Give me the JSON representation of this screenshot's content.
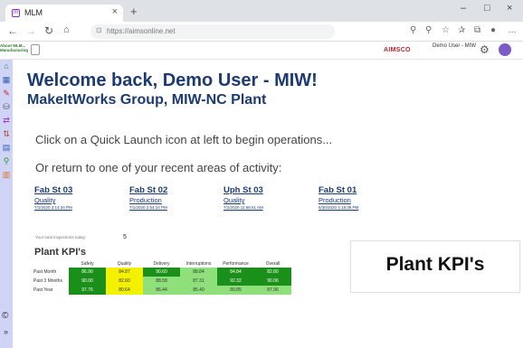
{
  "browser": {
    "tab_title": "MLM",
    "tab_favicon": "mlm-favicon",
    "url": "https://aimsonline.net",
    "window_controls": [
      "–",
      "□",
      "×"
    ]
  },
  "app": {
    "logo_text": "About MLM... Manufacturing",
    "brand": "AIMSCO",
    "user_label": "Demo User - MIW"
  },
  "sidebar": {
    "icons": [
      "home-icon",
      "calendar-icon",
      "wrench-icon",
      "database-icon",
      "transfer-icon",
      "arrows-icon",
      "clipboard-icon",
      "search-icon",
      "bar-chart-icon"
    ],
    "copyright": "©",
    "expand": "»"
  },
  "main": {
    "welcome": "Welcome back, Demo User - MIW!",
    "plant": "MakeItWorks Group, MIW-NC Plant",
    "quick_launch": "Click on a Quick Launch icon at left to begin operations...",
    "recent_prompt": "Or return to one of your recent areas of activity:",
    "recent": [
      {
        "title": "Fab St 03",
        "type": "Quality",
        "date": "7/1/2020 3:14:34 PM"
      },
      {
        "title": "Fab St 02",
        "type": "Production",
        "date": "7/1/2020 2:54:24 PM"
      },
      {
        "title": "Uph St 03",
        "type": "Quality",
        "date": "7/1/2020 11:56:51 AM"
      },
      {
        "title": "Fab St 01",
        "type": "Production",
        "date": "6/30/2020 4:18:38 PM"
      }
    ],
    "inspections_label": "Your total inspections today:",
    "inspections_value": "5",
    "kpi_title": "Plant KPI's",
    "kpi": {
      "headers": [
        "",
        "Safety",
        "Quality",
        "Delivery",
        "Interruptions",
        "Performance",
        "Overall"
      ],
      "rows": [
        {
          "label": "Past Month",
          "values": [
            "86.90",
            "84.87",
            "90.60",
            "88.84",
            "84.84",
            "82.80"
          ],
          "colors": [
            "g",
            "y",
            "g",
            "lg",
            "g",
            "g"
          ]
        },
        {
          "label": "Past 3 Months",
          "values": [
            "90.00",
            "82.60",
            "88.58",
            "87.31",
            "92.32",
            "90.06"
          ],
          "colors": [
            "g",
            "y",
            "lg",
            "lg",
            "g",
            "g"
          ]
        },
        {
          "label": "Past Year",
          "values": [
            "97.76",
            "80.64",
            "86.44",
            "85.40",
            "89.85",
            "87.96"
          ],
          "colors": [
            "g",
            "y",
            "lg",
            "lg",
            "lg",
            "lg"
          ]
        }
      ]
    },
    "callout": "Plant KPI's"
  },
  "colors": {
    "heading": "#1d3b73",
    "sidebar": "#cfd3f5",
    "kpi_green": "#1a8f1a",
    "kpi_yellow": "#f3f000",
    "kpi_light_green": "#8fe07a",
    "brand_red": "#c0202a"
  }
}
